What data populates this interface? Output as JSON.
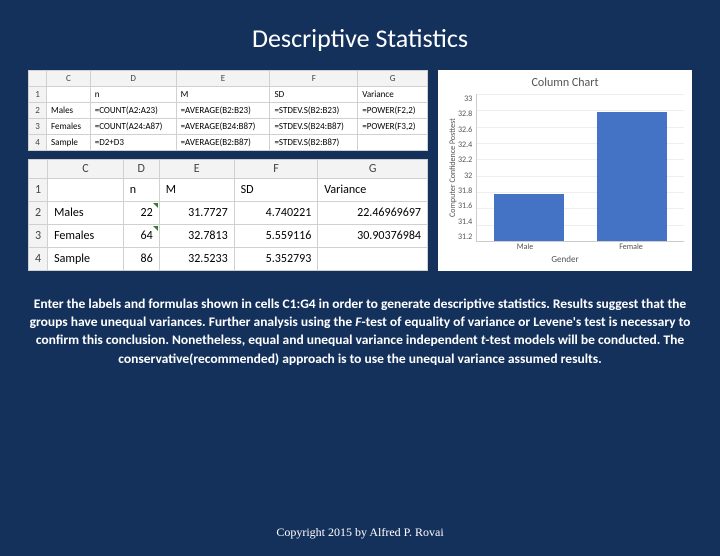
{
  "title": "Descriptive Statistics",
  "sheet_formulas": {
    "cols": [
      "",
      "C",
      "D",
      "E",
      "F",
      "G"
    ],
    "rows": [
      {
        "n": "1",
        "c": "",
        "d": "n",
        "e": "M",
        "f": "SD",
        "g": "Variance"
      },
      {
        "n": "2",
        "c": "Males",
        "d": "=COUNT(A2:A23)",
        "e": "=AVERAGE(B2:B23)",
        "f": "=STDEV.S(B2:B23)",
        "g": "=POWER(F2,2)"
      },
      {
        "n": "3",
        "c": "Females",
        "d": "=COUNT(A24:A87)",
        "e": "=AVERAGE(B24:B87)",
        "f": "=STDEV.S(B24:B87)",
        "g": "=POWER(F3,2)"
      },
      {
        "n": "4",
        "c": "Sample",
        "d": "=D2+D3",
        "e": "=AVERAGE(B2:B87)",
        "f": "=STDEV.S(B2:B87)",
        "g": ""
      }
    ]
  },
  "sheet_values": {
    "cols": [
      "",
      "C",
      "D",
      "E",
      "F",
      "G"
    ],
    "rows": [
      {
        "n": "1",
        "c": "",
        "d": "n",
        "e": "M",
        "f": "SD",
        "g": "Variance"
      },
      {
        "n": "2",
        "c": "Males",
        "d": "22",
        "e": "31.7727",
        "f": "4.740221",
        "g": "22.46969697"
      },
      {
        "n": "3",
        "c": "Females",
        "d": "64",
        "e": "32.7813",
        "f": "5.559116",
        "g": "30.90376984"
      },
      {
        "n": "4",
        "c": "Sample",
        "d": "86",
        "e": "32.5233",
        "f": "5.352793",
        "g": ""
      }
    ]
  },
  "chart_data": {
    "type": "bar",
    "title": "Column Chart",
    "xlabel": "Gender",
    "ylabel": "Computer Confidence Posttest",
    "categories": [
      "Male",
      "Female"
    ],
    "values": [
      31.7727,
      32.7813
    ],
    "yticks": [
      "33",
      "32.8",
      "32.6",
      "32.4",
      "32.2",
      "32",
      "31.8",
      "31.6",
      "31.4",
      "31.2"
    ],
    "ylim": [
      31.2,
      33
    ]
  },
  "desc": {
    "p1a": "Enter the labels and formulas shown in cells C1:G4 in order to generate descriptive statistics. Results suggest that the groups have unequal variances. Further analysis using the ",
    "f": "F",
    "p1b": "-test of equality of variance or Levene's test is necessary to confirm this conclusion. Nonetheless, equal and unequal variance independent ",
    "t": "t",
    "p1c": "-test models will be conducted. The conservative(recommended) approach is to use the unequal variance assumed results."
  },
  "copyright": "Copyright 2015 by Alfred P. Rovai"
}
